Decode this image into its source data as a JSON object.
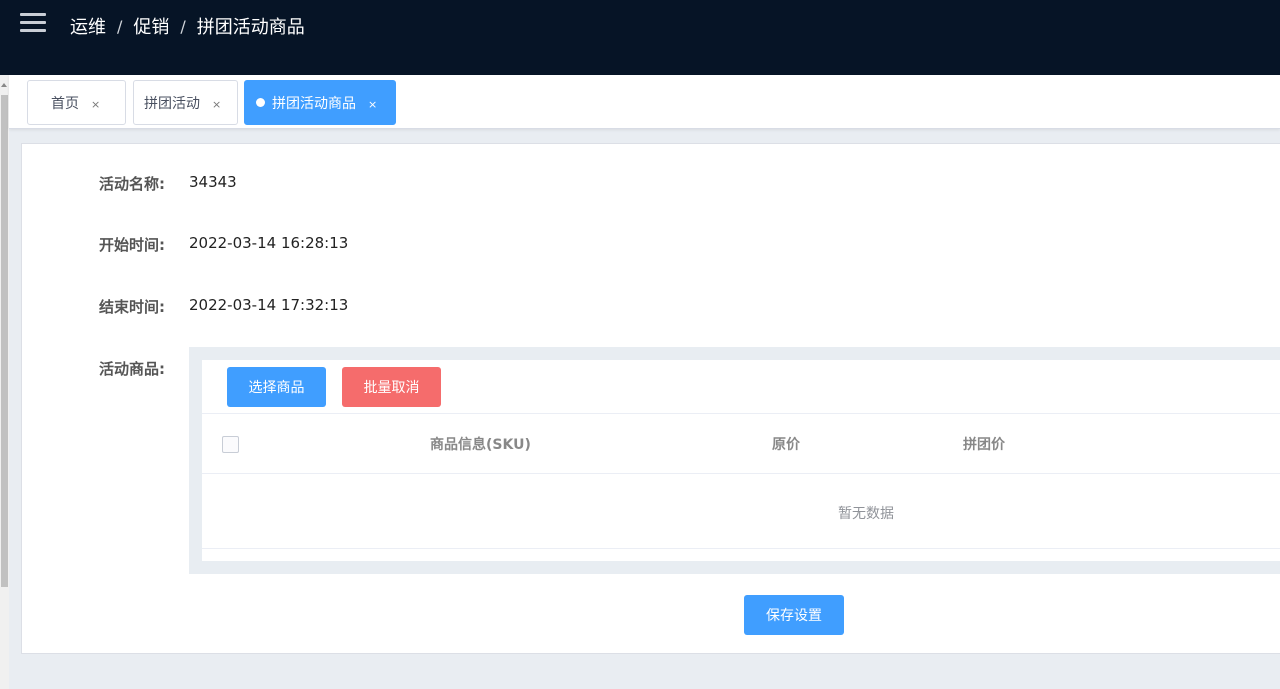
{
  "header": {
    "breadcrumb": [
      "运维",
      "促销",
      "拼团活动商品"
    ],
    "separator": "/",
    "bg_color": "#061426"
  },
  "tabs": [
    {
      "label": "首页",
      "close": "×",
      "active": false
    },
    {
      "label": "拼团活动",
      "close": "×",
      "active": false
    },
    {
      "label": "拼团活动商品",
      "close": "×",
      "active": true
    }
  ],
  "form": {
    "activity_name_label": "活动名称:",
    "activity_name_value": "34343",
    "start_time_label": "开始时间:",
    "start_time_value": "2022-03-14 16:28:13",
    "end_time_label": "结束时间:",
    "end_time_value": "2022-03-14 17:32:13",
    "goods_label": "活动商品:"
  },
  "goods": {
    "select_button": "选择商品",
    "batch_cancel_button": "批量取消",
    "columns": [
      "商品信息(SKU)",
      "原价",
      "拼团价"
    ],
    "empty_text": "暂无数据"
  },
  "save_button": "保存设置",
  "colors": {
    "primary": "#409eff",
    "danger": "#f56c6c",
    "header": "#061426"
  },
  "icons": [
    "menu-icon",
    "close-icon",
    "active-dot-icon"
  ]
}
